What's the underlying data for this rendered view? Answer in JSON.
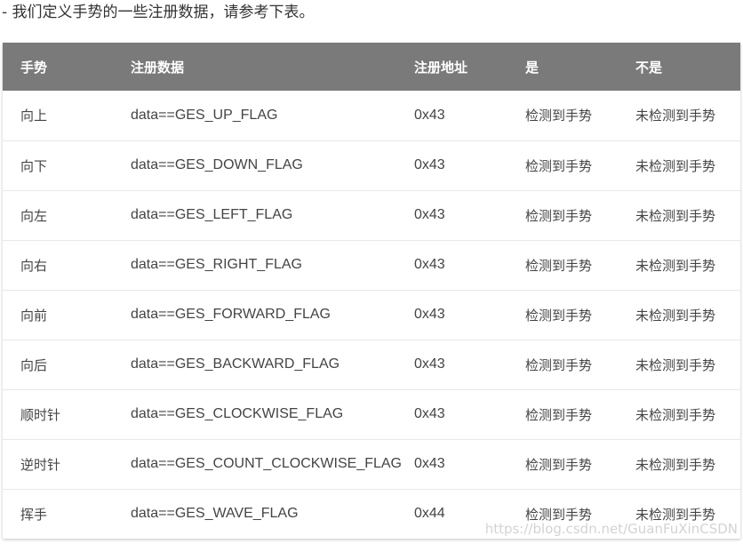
{
  "intro_text": "- 我们定义手势的一些注册数据，请参考下表。",
  "table": {
    "headers": [
      "手势",
      "注册数据",
      "注册地址",
      "是",
      "不是"
    ],
    "rows": [
      [
        "向上",
        "data==GES_UP_FLAG",
        "0x43",
        "检测到手势",
        "未检测到手势"
      ],
      [
        "向下",
        "data==GES_DOWN_FLAG",
        "0x43",
        "检测到手势",
        "未检测到手势"
      ],
      [
        "向左",
        "data==GES_LEFT_FLAG",
        "0x43",
        "检测到手势",
        "未检测到手势"
      ],
      [
        "向右",
        "data==GES_RIGHT_FLAG",
        "0x43",
        "检测到手势",
        "未检测到手势"
      ],
      [
        "向前",
        "data==GES_FORWARD_FLAG",
        "0x43",
        "检测到手势",
        "未检测到手势"
      ],
      [
        "向后",
        "data==GES_BACKWARD_FLAG",
        "0x43",
        "检测到手势",
        "未检测到手势"
      ],
      [
        "顺时针",
        "data==GES_CLOCKWISE_FLAG",
        "0x43",
        "检测到手势",
        "未检测到手势"
      ],
      [
        "逆时针",
        "data==GES_COUNT_CLOCKWISE_FLAG",
        "0x43",
        "检测到手势",
        "未检测到手势"
      ],
      [
        "挥手",
        "data==GES_WAVE_FLAG",
        "0x44",
        "检测到手势",
        "未检测到手势"
      ]
    ]
  },
  "watermark": "https://blog.csdn.net/GuanFuXinCSDN",
  "colors": {
    "header_bg": "#7a7a7a",
    "header_text": "#ffffff",
    "row_divider": "#e8e8e8"
  }
}
